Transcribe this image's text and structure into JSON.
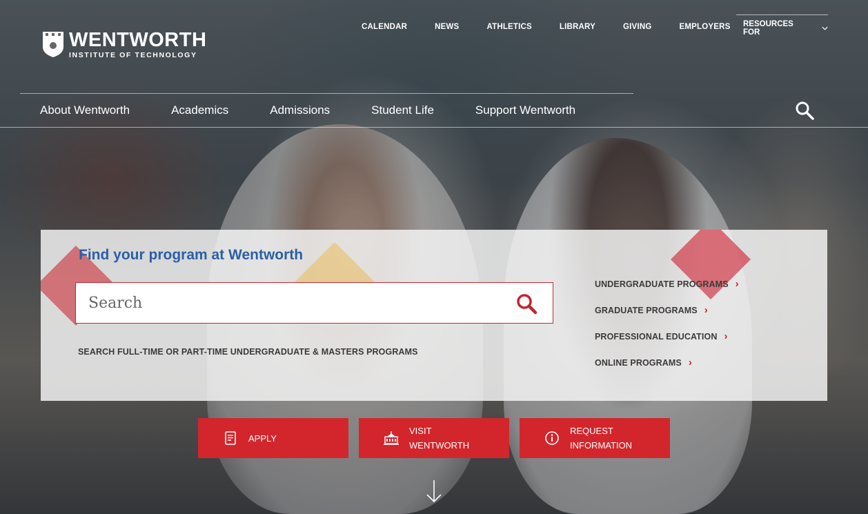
{
  "header": {
    "logo": {
      "name": "WENTWORTH",
      "subtitle": "INSTITUTE OF TECHNOLOGY"
    },
    "utility_nav": [
      "CALENDAR",
      "NEWS",
      "ATHLETICS",
      "LIBRARY",
      "GIVING",
      "EMPLOYERS"
    ],
    "resources_label": "RESOURCES FOR",
    "main_nav": [
      "About Wentworth",
      "Academics",
      "Admissions",
      "Student Life",
      "Support Wentworth"
    ]
  },
  "finder": {
    "title": "Find your program at Wentworth",
    "search_placeholder": "Search",
    "note": "SEARCH FULL-TIME OR PART-TIME UNDERGRADUATE & MASTERS PROGRAMS",
    "links": [
      "UNDERGRADUATE PROGRAMS",
      "GRADUATE PROGRAMS",
      "PROFESSIONAL EDUCATION",
      "ONLINE PROGRAMS"
    ],
    "link_arrow": "›"
  },
  "cta": {
    "apply": "APPLY",
    "visit": "VISIT WENTWORTH",
    "request": "REQUEST INFORMATION"
  },
  "colors": {
    "brand_red": "#d2262c",
    "title_blue": "#2b5fa6"
  },
  "icons": [
    "search-icon",
    "chevron-down-icon",
    "document-icon",
    "building-icon",
    "info-icon",
    "arrow-down-icon"
  ]
}
